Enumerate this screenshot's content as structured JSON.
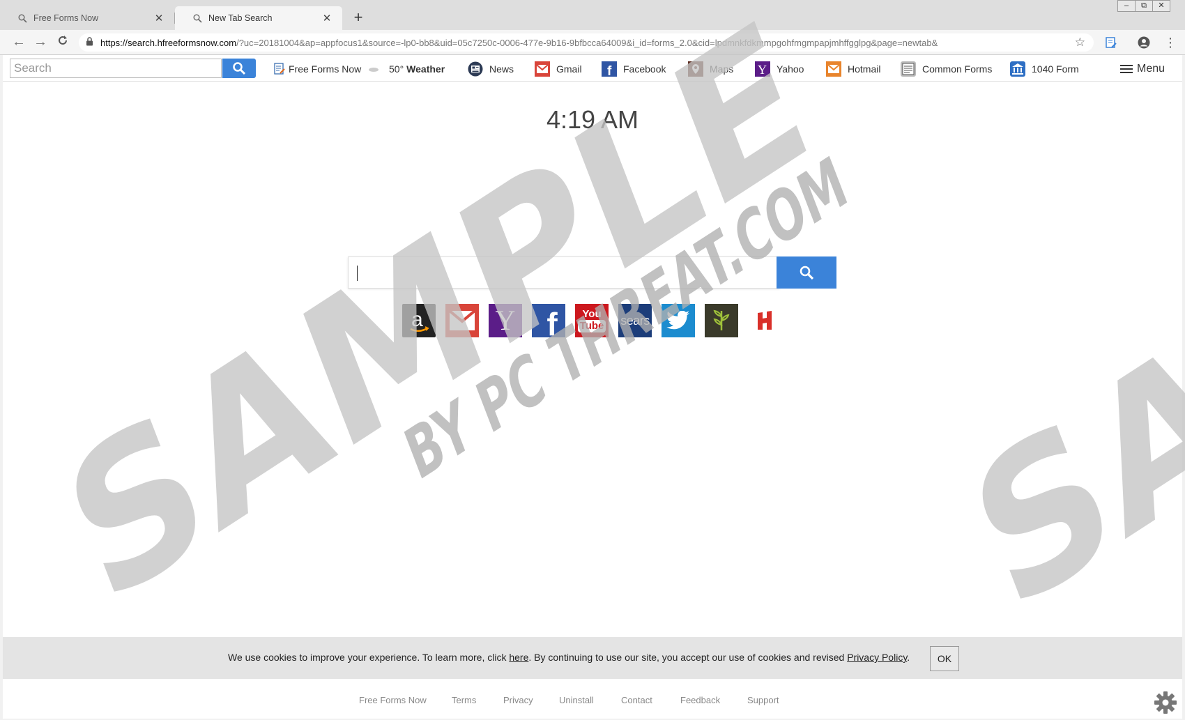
{
  "browser": {
    "tabs": [
      {
        "label": "Free Forms Now",
        "icon": "search-icon"
      },
      {
        "label": "New Tab Search",
        "icon": "search-icon"
      }
    ],
    "new_tab_symbol": "+",
    "window_controls": [
      "▭",
      "⧉",
      "✕"
    ],
    "url_host": "https://search.hfreeformsnow.com",
    "url_rest": "/?uc=20181004&ap=appfocus1&source=-lp0-bb8&uid=05c7250c-0006-477e-9b16-9bfbcca64009&i_id=forms_2.0&cid=lpdmnkfdkmmpgohfmgmpapjmhffgglpg&page=newtab&"
  },
  "topbar": {
    "search_placeholder": "Search",
    "links": {
      "free_forms": "Free Forms Now",
      "weather_value": "50°",
      "weather_label": "Weather",
      "news": "News",
      "gmail": "Gmail",
      "facebook": "Facebook",
      "maps": "Maps",
      "yahoo": "Yahoo",
      "hotmail": "Hotmail",
      "common_forms": "Common Forms",
      "form_1040": "1040 Form"
    },
    "menu_label": "Menu"
  },
  "clock": "4:19 AM",
  "shortcuts": {
    "yahoo_letter": "Y",
    "facebook_letter": "f",
    "youtube_you": "You",
    "youtube_tube": "Tube",
    "sears": "sears"
  },
  "cookie": {
    "text_1": "We use cookies to improve your experience. To learn more, click ",
    "link_here": "here",
    "text_2": ". By continuing to use our site, you accept our use of cookies and revised ",
    "link_privacy": "Privacy Policy",
    "text_3": ".",
    "ok": "OK"
  },
  "footer": {
    "links": [
      "Free Forms Now",
      "Terms",
      "Privacy",
      "Uninstall",
      "Contact",
      "Feedback",
      "Support"
    ]
  },
  "watermark": {
    "line1": "SAMPLE",
    "line2": "BY PC THREAT.COM",
    "right": "SA"
  },
  "colors": {
    "accent": "#3b83d9",
    "tab_active": "#f5f5f5",
    "tabstrip": "#dedede",
    "cookie_bar": "#e4e4e4"
  }
}
